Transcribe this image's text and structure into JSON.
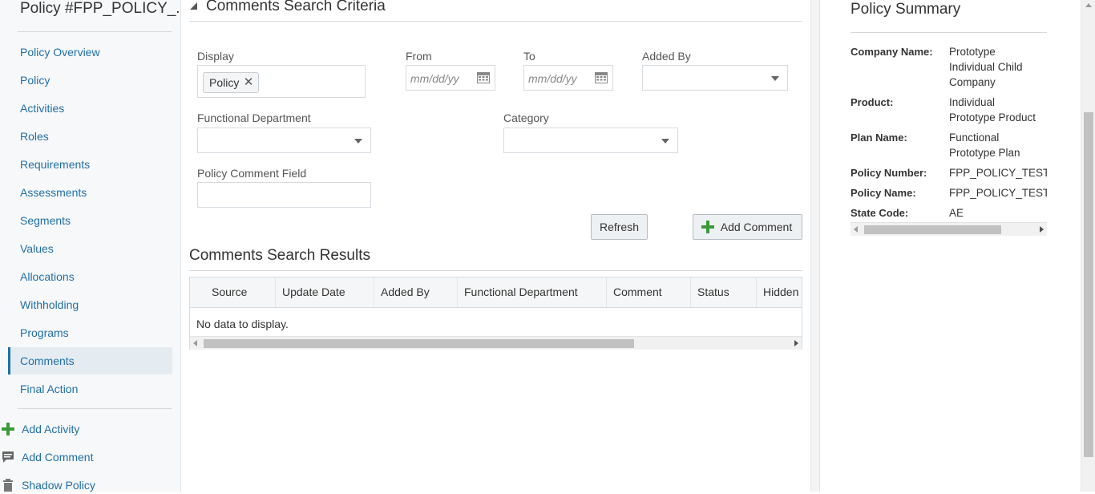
{
  "nav": {
    "title": "Policy #FPP_POLICY_...",
    "items": [
      {
        "label": "Policy Overview"
      },
      {
        "label": "Policy"
      },
      {
        "label": "Activities"
      },
      {
        "label": "Roles"
      },
      {
        "label": "Requirements"
      },
      {
        "label": "Assessments"
      },
      {
        "label": "Segments"
      },
      {
        "label": "Values"
      },
      {
        "label": "Allocations"
      },
      {
        "label": "Withholding"
      },
      {
        "label": "Programs"
      },
      {
        "label": "Comments",
        "active": true
      },
      {
        "label": "Final Action"
      }
    ],
    "actions": [
      {
        "label": "Add Activity",
        "icon": "plus-icon"
      },
      {
        "label": "Add Comment",
        "icon": "comment-icon"
      },
      {
        "label": "Shadow Policy",
        "icon": "trash-icon"
      }
    ]
  },
  "criteria": {
    "title": "Comments Search Criteria",
    "display_label": "Display",
    "display_chip": "Policy",
    "from_label": "From",
    "from_placeholder": "mm/dd/yy",
    "to_label": "To",
    "to_placeholder": "mm/dd/yy",
    "added_by_label": "Added By",
    "functional_department_label": "Functional Department",
    "category_label": "Category",
    "policy_comment_label": "Policy Comment Field",
    "refresh_label": "Refresh",
    "add_comment_label": "Add Comment"
  },
  "results": {
    "title": "Comments Search Results",
    "columns": [
      "Source",
      "Update Date",
      "Added By",
      "Functional Department",
      "Comment",
      "Status",
      "Hidden"
    ],
    "empty_text": "No data to display."
  },
  "summary": {
    "title": "Policy Summary",
    "rows": [
      {
        "label": "Company Name:",
        "value_lines": [
          "Prototype",
          "Individual Child",
          "Company"
        ]
      },
      {
        "label": "Product:",
        "value_lines": [
          "Individual",
          "Prototype Product"
        ]
      },
      {
        "label": "Plan Name:",
        "value_lines": [
          "Functional",
          "Prototype Plan"
        ]
      },
      {
        "label": "Policy Number:",
        "value_lines": [
          "FPP_POLICY_TESTAU"
        ]
      },
      {
        "label": "Policy Name:",
        "value_lines": [
          "FPP_POLICY_TESTAU"
        ]
      },
      {
        "label": "State Code:",
        "value_lines": [
          "AE"
        ]
      }
    ]
  },
  "colors": {
    "link": "#1f6fa8",
    "accent_green": "#3a9a3a",
    "nav_bg": "#f7f8f9",
    "active_bg": "#e4ecf2"
  }
}
